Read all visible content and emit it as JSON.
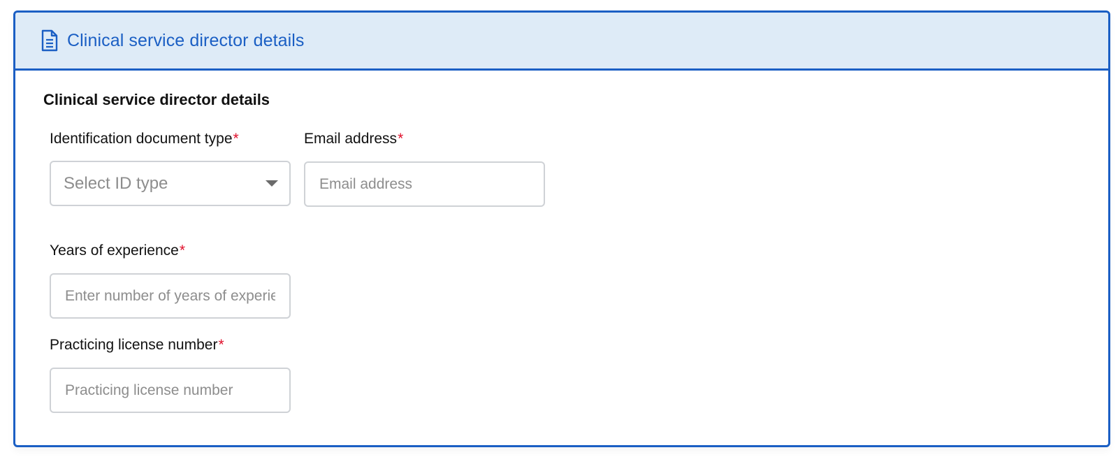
{
  "panel": {
    "header_icon": "document-icon",
    "header_title": "Clinical service director details",
    "accent_color": "#1b5fc4",
    "header_bg": "#deebf7"
  },
  "section": {
    "title": "Clinical service director details"
  },
  "fields": {
    "id_type": {
      "label": "Identification document type",
      "required_mark": "*",
      "selected_text": "Select ID type"
    },
    "email": {
      "label": "Email address",
      "required_mark": "*",
      "placeholder": "Email address"
    },
    "experience": {
      "label": "Years of experience",
      "required_mark": "*",
      "placeholder": "Enter number of years of experience"
    },
    "license": {
      "label": "Practicing license number",
      "required_mark": "*",
      "placeholder": "Practicing license number"
    }
  }
}
